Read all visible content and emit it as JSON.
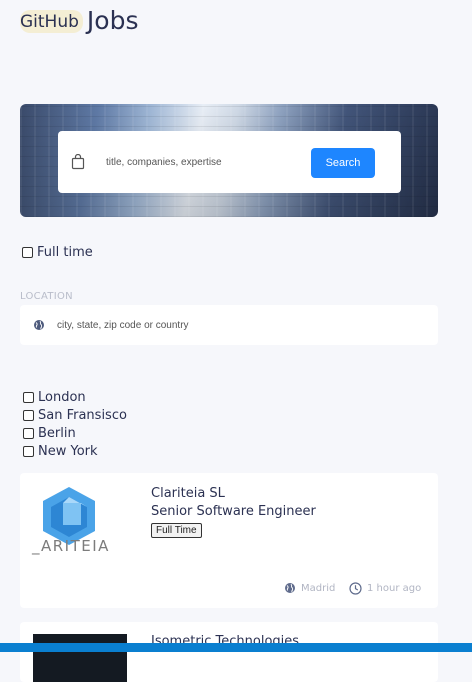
{
  "brand": {
    "prefix": "GitHub",
    "suffix": "Jobs"
  },
  "search": {
    "placeholder": "title, companies, expertise",
    "button_label": "Search"
  },
  "filters": {
    "full_time_label": "Full time"
  },
  "location": {
    "label": "LOCATION",
    "placeholder": "city, state, zip code or country",
    "options": [
      "London",
      "San Fransisco",
      "Berlin",
      "New York"
    ]
  },
  "jobs": [
    {
      "logo_text": "_ARITEIA",
      "company": "Clariteia SL",
      "title": "Senior Software Engineer",
      "type": "Full Time",
      "location": "Madrid",
      "posted": "1 hour ago"
    },
    {
      "company": "Isometric Technologies"
    }
  ],
  "colors": {
    "accent": "#1e86ff",
    "text": "#2b3152",
    "muted": "#b1b5c3"
  }
}
